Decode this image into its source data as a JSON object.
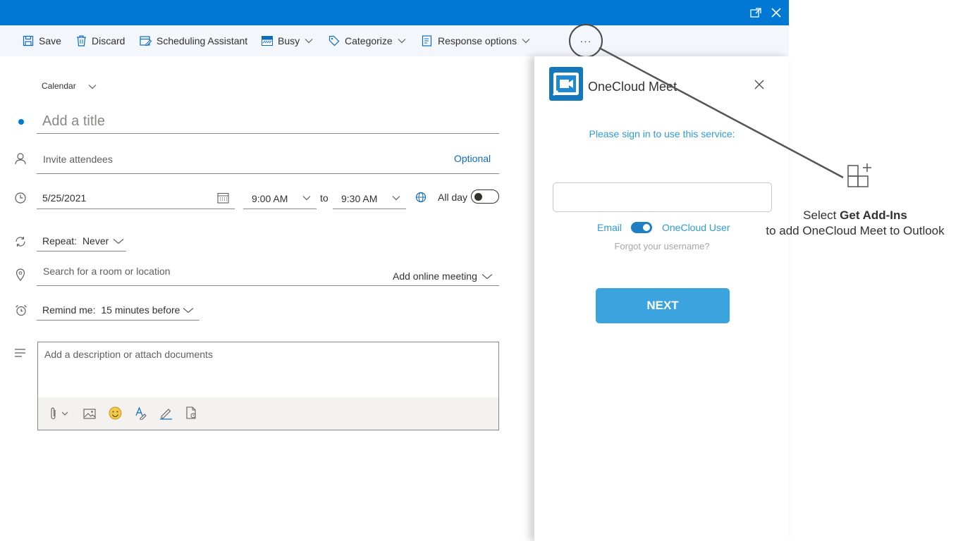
{
  "toolbar": {
    "save": "Save",
    "discard": "Discard",
    "scheduling": "Scheduling Assistant",
    "busy": "Busy",
    "categorize": "Categorize",
    "response": "Response options",
    "more": "···"
  },
  "form": {
    "calendar": "Calendar",
    "title_placeholder": "Add a title",
    "attendees_placeholder": "Invite attendees",
    "optional": "Optional",
    "date": "5/25/2021",
    "start_time": "9:00 AM",
    "to": "to",
    "end_time": "9:30 AM",
    "all_day": "All day",
    "repeat_label": "Repeat:",
    "repeat_value": "Never",
    "location_placeholder": "Search for a room or location",
    "online_meeting": "Add online meeting",
    "remind_label": "Remind me:",
    "remind_value": "15 minutes before",
    "description_placeholder": "Add a description or attach documents"
  },
  "addin": {
    "name": "OneCloud Meet",
    "signin_prompt": "Please sign in to use this service:",
    "username_value": "",
    "toggle_left": "Email",
    "toggle_right": "OneCloud User",
    "forgot": "Forgot your username?",
    "next": "NEXT"
  },
  "callout": {
    "select": "Select",
    "bold": "Get Add-Ins",
    "line2": "to add OneCloud Meet to Outlook"
  },
  "colors": {
    "accent": "#0078d4",
    "addin_blue": "#2e9bd6",
    "next_button": "#3ba3dd"
  }
}
